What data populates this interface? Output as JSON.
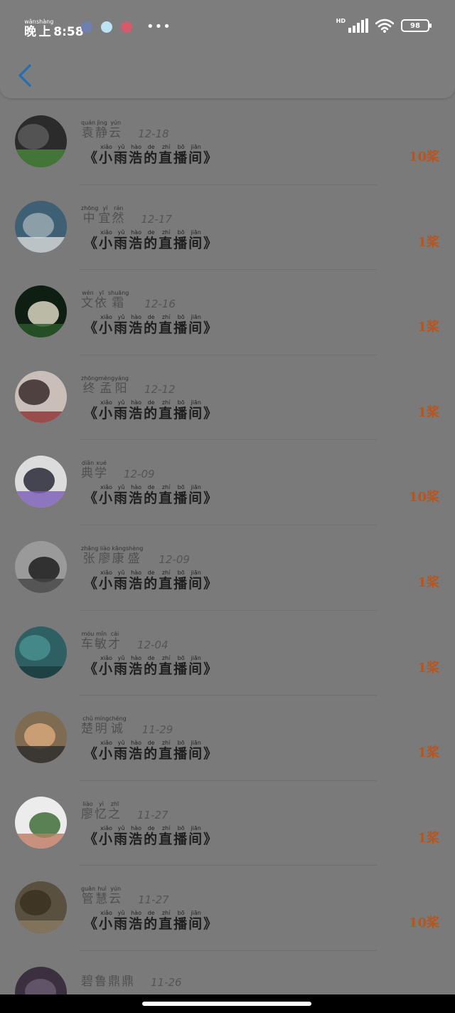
{
  "status_bar": {
    "time_prefix": "晚上",
    "time_prefix_pinyin": [
      "wǎn",
      "shàng"
    ],
    "time": "8:58",
    "more": "•••",
    "network": "HD",
    "battery": "98",
    "notif_colors": [
      "#6f7fb0",
      "#bde4f5",
      "#d45c6a"
    ]
  },
  "header": {
    "back_icon": "chevron-left-icon",
    "accent_color": "#1e6fb4"
  },
  "title_chars": [
    "小",
    "雨",
    "浩",
    "的",
    "直",
    "播",
    "间"
  ],
  "title_pinyin": [
    "xiǎo",
    "yǔ",
    "hào",
    "de",
    "zhí",
    "bō",
    "jiān"
  ],
  "title_open": "《",
  "title_close": "》",
  "count_color": "#b8551e",
  "items": [
    {
      "name": "袁静云",
      "pinyin": [
        "quán",
        "jìng",
        "yún"
      ],
      "date": "12-18",
      "count": "10桨"
    },
    {
      "name": "中宜然",
      "pinyin": [
        "zhōng",
        "yí",
        "rán"
      ],
      "date": "12-17",
      "count": "1桨"
    },
    {
      "name": "文依霜",
      "pinyin": [
        "wén",
        "yī",
        "shuāng"
      ],
      "date": "12-16",
      "count": "1桨"
    },
    {
      "name": "终孟阳",
      "pinyin": [
        "zhōng",
        "mèng",
        "yáng"
      ],
      "date": "12-12",
      "count": "1桨"
    },
    {
      "name": "典学",
      "pinyin": [
        "diǎn",
        "xué"
      ],
      "date": "12-09",
      "count": "10桨"
    },
    {
      "name": "张廖康盛",
      "pinyin": [
        "zhāng",
        "liào",
        "kāng",
        "shèng"
      ],
      "date": "12-09",
      "count": "1桨"
    },
    {
      "name": "车敏才",
      "pinyin": [
        "móu",
        "mǐn",
        "cái"
      ],
      "date": "12-04",
      "count": "1桨"
    },
    {
      "name": "楚明诚",
      "pinyin": [
        "chǔ",
        "míng",
        "chéng"
      ],
      "date": "11-29",
      "count": "1桨"
    },
    {
      "name": "廖忆之",
      "pinyin": [
        "liào",
        "yì",
        "zhī"
      ],
      "date": "11-27",
      "count": "1桨"
    },
    {
      "name": "管慧云",
      "pinyin": [
        "guǎn",
        "huì",
        "yún"
      ],
      "date": "11-27",
      "count": "10桨"
    },
    {
      "name": "碧鲁鼎鼎",
      "pinyin": [],
      "date": "11-26",
      "count": ""
    }
  ],
  "avatar_palettes": [
    [
      "#2b2b2b",
      "#5a5a5a",
      "#4a8a3a"
    ],
    [
      "#3e5f74",
      "#9aa9b0",
      "#dcdcdc"
    ],
    [
      "#0f1e12",
      "#d8d6c2",
      "#2a5a2a"
    ],
    [
      "#c9bfb8",
      "#3a2a2a",
      "#8c2f2f"
    ],
    [
      "#dcdcdc",
      "#2a2a3a",
      "#7b5bb8"
    ],
    [
      "#9a9a9a",
      "#1e1e1e",
      "#444"
    ],
    [
      "#2d5f63",
      "#4a8f8f",
      "#1a3a3c"
    ],
    [
      "#7f6a52",
      "#d7a77a",
      "#2a2a2a"
    ],
    [
      "#ececec",
      "#3f6e3a",
      "#c07a62"
    ],
    [
      "#5a5040",
      "#3a3020",
      "#8a7a62"
    ],
    [
      "#3a3040",
      "#6a5a70",
      "#8a8a8a"
    ]
  ]
}
